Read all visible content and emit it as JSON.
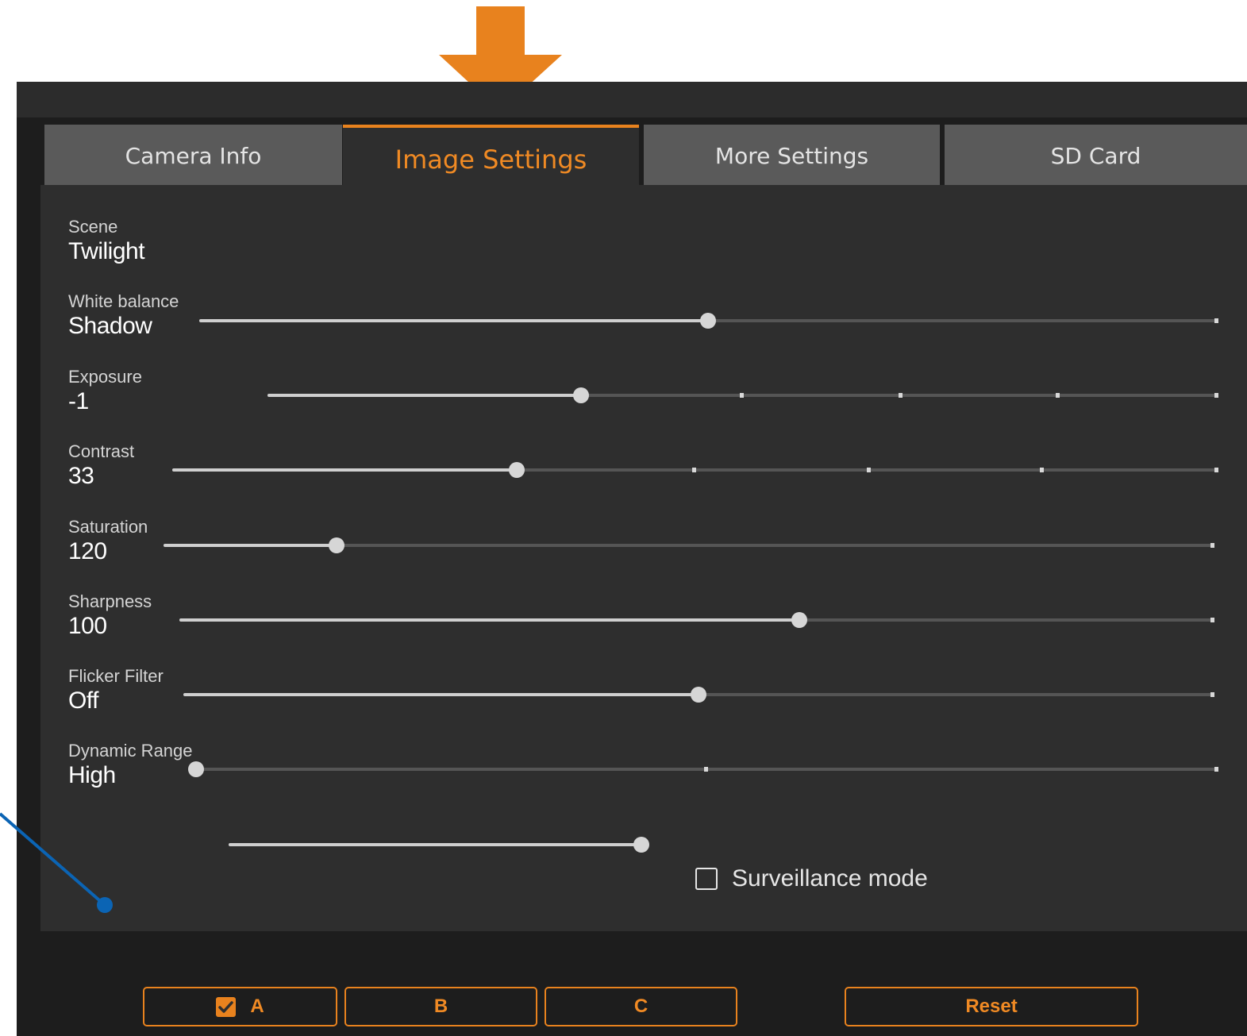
{
  "tabs": [
    {
      "label": "Camera Info",
      "active": false
    },
    {
      "label": "Image Settings",
      "active": true
    },
    {
      "label": "More Settings",
      "active": false
    },
    {
      "label": "SD Card",
      "active": false
    }
  ],
  "settings": [
    {
      "label": "Scene",
      "value": "Twilight",
      "level": 0.5,
      "ticks": []
    },
    {
      "label": "White balance",
      "value": "Shadow",
      "level": 0.33,
      "ticks": [
        0.5,
        0.667,
        0.833
      ]
    },
    {
      "label": "Exposure",
      "value": "-1",
      "level": 0.33,
      "ticks": [
        0.5,
        0.667,
        0.833
      ]
    },
    {
      "label": "Contrast",
      "value": "33",
      "level": 0.165,
      "ticks": []
    },
    {
      "label": "Saturation",
      "value": "120",
      "level": 0.6,
      "ticks": []
    },
    {
      "label": "Sharpness",
      "value": "100",
      "level": 0.5,
      "ticks": []
    },
    {
      "label": "Flicker Filter",
      "value": "Off",
      "level": 0.0,
      "ticks": [
        0.5
      ]
    },
    {
      "label": "Dynamic Range",
      "value": "High",
      "level": 1.0,
      "ticks": []
    }
  ],
  "surveillance": {
    "label": "Surveillance mode",
    "checked": false
  },
  "presets": [
    {
      "label": "A",
      "checked": true
    },
    {
      "label": "B",
      "checked": false
    },
    {
      "label": "C",
      "checked": false
    }
  ],
  "reset_label": "Reset",
  "colors": {
    "accent": "#e8821e",
    "annotation": "#0b64b4",
    "panel": "#2e2e2e",
    "tab": "#5a5a5a"
  },
  "icons": {
    "annotation_arrow": "arrow-down-icon",
    "annotation_pointer": "pointer-line-icon",
    "check": "check-icon"
  }
}
